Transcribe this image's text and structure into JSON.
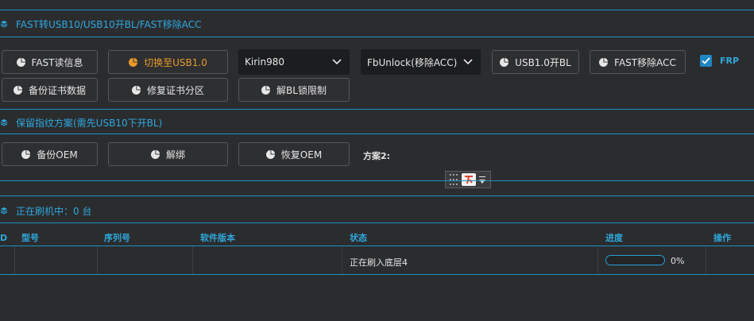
{
  "sections": {
    "fast_title": "FAST转USB10/USB10开BL/FAST移除ACC",
    "fingerprint_title": "保留指纹方案(需先USB10下开BL)",
    "flashing_title": "正在刷机中：0 台"
  },
  "fast_buttons": {
    "read_info": "FAST读信息",
    "switch_usb": "切换至USB1.0",
    "usb_open_bl": "USB1.0开BL",
    "fast_remove_acc": "FAST移除ACC",
    "backup_cert": "备份证书数据",
    "repair_cert": "修复证书分区",
    "unlock_bl_limit": "解BL锁限制"
  },
  "selects": {
    "chip": "Kirin980",
    "mode": "FbUnlock(移除ACC)"
  },
  "frp": {
    "label": "FRP",
    "checked": true
  },
  "fingerprint_buttons": {
    "backup_oem": "备份OEM",
    "unbind": "解绑",
    "restore_oem": "恢复OEM",
    "plan2_label": "方案2:"
  },
  "table": {
    "headers": {
      "id": "D",
      "model": "型号",
      "serial": "序列号",
      "software": "软件版本",
      "status": "状态",
      "progress": "进度",
      "action": "操作"
    },
    "rows": [
      {
        "id": "",
        "model": "",
        "serial": "",
        "software": "",
        "status": "正在刷入底层4",
        "progress_text": "0%",
        "progress_value": 0.0,
        "action": ""
      }
    ]
  },
  "colors": {
    "accent": "#2ea8de",
    "orange": "#e89a2c",
    "background": "#2b2c2e"
  },
  "icons": {
    "section": "layers-icon",
    "button": "pie-chart-icon",
    "select": "chevron-down-icon",
    "checkbox": "check-icon"
  }
}
